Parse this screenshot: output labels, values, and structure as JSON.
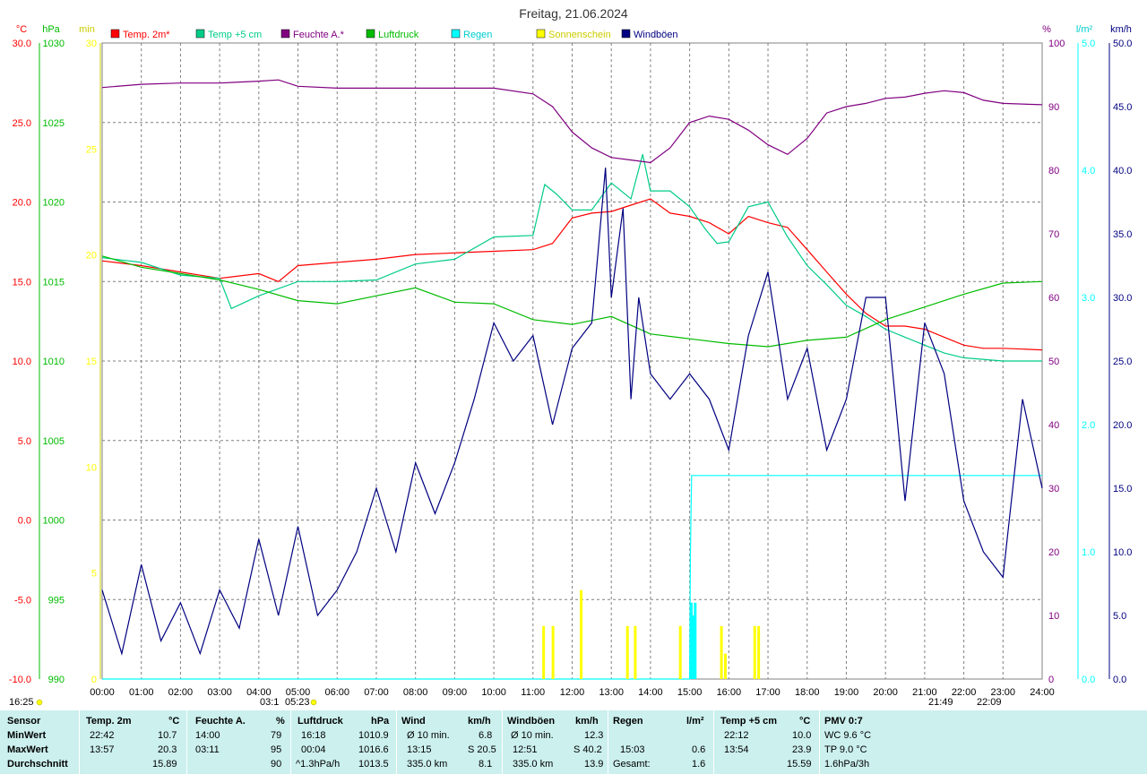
{
  "chart_data": {
    "type": "line",
    "title": "Freitag, 21.06.2024",
    "x_ticks": [
      "00:00",
      "01:00",
      "02:00",
      "03:00",
      "04:00",
      "05:00",
      "06:00",
      "07:00",
      "08:00",
      "09:00",
      "10:00",
      "11:00",
      "12:00",
      "13:00",
      "14:00",
      "15:00",
      "16:00",
      "17:00",
      "18:00",
      "19:00",
      "20:00",
      "21:00",
      "22:00",
      "23:00",
      "24:00"
    ],
    "grid": true,
    "axes": [
      {
        "id": "temp",
        "unit": "°C",
        "color": "#ff0000",
        "range": [
          -10,
          30
        ],
        "ticks": [
          "-10.0",
          "-5.0",
          "0.0",
          "5.0",
          "10.0",
          "15.0",
          "20.0",
          "25.0",
          "30.0"
        ],
        "side": "left"
      },
      {
        "id": "press",
        "unit": "hPa",
        "color": "#00bb00",
        "range": [
          990,
          1030
        ],
        "ticks": [
          "990",
          "995",
          "1000",
          "1005",
          "1010",
          "1015",
          "1020",
          "1025",
          "1030"
        ],
        "side": "left"
      },
      {
        "id": "sun",
        "unit": "min",
        "color": "#ffff00",
        "range": [
          0,
          30
        ],
        "ticks": [
          "0",
          "5",
          "10",
          "15",
          "20",
          "25",
          "30"
        ],
        "side": "left"
      },
      {
        "id": "hum",
        "unit": "%",
        "color": "#800080",
        "range": [
          0,
          100
        ],
        "ticks": [
          "0",
          "10",
          "20",
          "30",
          "40",
          "50",
          "60",
          "70",
          "80",
          "90",
          "100"
        ],
        "side": "right"
      },
      {
        "id": "rain",
        "unit": "l/m²",
        "color": "#00ffff",
        "range": [
          0,
          5
        ],
        "ticks": [
          "0.0",
          "1.0",
          "2.0",
          "3.0",
          "4.0",
          "5.0"
        ],
        "side": "right"
      },
      {
        "id": "wind",
        "unit": "km/h",
        "color": "#000080",
        "range": [
          0,
          50
        ],
        "ticks": [
          "0.0",
          "5.0",
          "10.0",
          "15.0",
          "20.0",
          "25.0",
          "30.0",
          "35.0",
          "40.0",
          "45.0",
          "50.0"
        ],
        "side": "right"
      }
    ],
    "legend": [
      {
        "name": "Temp. 2m*",
        "color": "#ff0000"
      },
      {
        "name": "Temp +5 cm",
        "color": "#00cc88"
      },
      {
        "name": "Feuchte A.*",
        "color": "#800080"
      },
      {
        "name": "Luftdruck",
        "color": "#00bb00"
      },
      {
        "name": "Regen",
        "color": "#00ffff"
      },
      {
        "name": "Sonnenschein",
        "color": "#ffff00"
      },
      {
        "name": "Windböen",
        "color": "#000080"
      }
    ],
    "series": [
      {
        "name": "Temp. 2m*",
        "axis": "temp",
        "color": "#ff0000",
        "x": [
          0,
          1,
          2,
          3,
          4,
          4.5,
          5,
          6,
          7,
          8,
          9,
          10,
          11,
          11.5,
          12,
          12.5,
          13,
          13.5,
          14,
          14.5,
          15,
          15.5,
          16,
          16.5,
          17,
          17.5,
          18,
          18.5,
          19,
          19.5,
          20,
          20.5,
          21,
          21.5,
          22,
          22.5,
          23,
          24
        ],
        "y": [
          16.3,
          16.0,
          15.6,
          15.2,
          15.5,
          15.0,
          16.0,
          16.2,
          16.4,
          16.7,
          16.8,
          16.9,
          17.0,
          17.4,
          19.0,
          19.3,
          19.4,
          19.8,
          20.2,
          19.3,
          19.1,
          18.7,
          18.0,
          19.1,
          18.7,
          18.4,
          17.0,
          15.6,
          14.2,
          13.0,
          12.2,
          12.2,
          12.0,
          11.5,
          11.0,
          10.8,
          10.8,
          10.7
        ]
      },
      {
        "name": "Temp +5 cm",
        "axis": "temp",
        "color": "#00cc88",
        "x": [
          0,
          1,
          2,
          3,
          3.3,
          4,
          5,
          6,
          7,
          8,
          9,
          10,
          11,
          11.3,
          11.6,
          12,
          12.5,
          13,
          13.5,
          13.8,
          14,
          14.5,
          15,
          15.4,
          15.7,
          16,
          16.5,
          17,
          17.5,
          18,
          18.5,
          19,
          19.5,
          20,
          20.5,
          21,
          21.5,
          22,
          23,
          24
        ],
        "y": [
          16.5,
          16.2,
          15.4,
          15.2,
          13.3,
          14.1,
          15.0,
          15.0,
          15.1,
          16.1,
          16.4,
          17.8,
          17.9,
          21.1,
          20.5,
          19.5,
          19.5,
          21.2,
          20.2,
          23.0,
          20.7,
          20.7,
          19.7,
          18.3,
          17.4,
          17.5,
          19.7,
          20.0,
          17.8,
          16.0,
          14.8,
          13.5,
          12.8,
          12.0,
          11.5,
          11.0,
          10.5,
          10.2,
          10.0,
          10.0
        ]
      },
      {
        "name": "Feuchte A.*",
        "axis": "hum",
        "color": "#800080",
        "x": [
          0,
          1,
          2,
          3,
          4,
          4.5,
          5,
          6,
          7,
          8,
          9,
          10,
          11,
          11.5,
          12,
          12.5,
          13,
          13.5,
          14,
          14.5,
          15,
          15.5,
          16,
          16.5,
          17,
          17.5,
          18,
          18.5,
          19,
          19.5,
          20,
          20.5,
          21,
          21.5,
          22,
          22.5,
          23,
          24
        ],
        "y": [
          93,
          93.5,
          93.7,
          93.7,
          94,
          94.2,
          93.2,
          92.9,
          92.9,
          92.9,
          92.9,
          92.9,
          92.0,
          90.0,
          86,
          83.5,
          82,
          81.6,
          81.2,
          83.5,
          87.5,
          88.5,
          88.0,
          86.3,
          84.0,
          82.5,
          85,
          89,
          90,
          90.5,
          91.3,
          91.5,
          92.1,
          92.5,
          92.2,
          91.0,
          90.5,
          90.3
        ]
      },
      {
        "name": "Luftdruck",
        "axis": "press",
        "color": "#00bb00",
        "x": [
          0,
          1,
          2,
          3,
          4,
          5,
          6,
          7,
          8,
          9,
          10,
          11,
          12,
          13,
          14,
          15,
          16,
          17,
          18,
          19,
          20,
          21,
          22,
          23,
          24
        ],
        "y": [
          1016.6,
          1015.9,
          1015.5,
          1015.1,
          1014.5,
          1013.8,
          1013.6,
          1014.1,
          1014.6,
          1013.7,
          1013.6,
          1012.6,
          1012.3,
          1012.8,
          1011.7,
          1011.4,
          1011.1,
          1010.9,
          1011.3,
          1011.5,
          1012.6,
          1013.4,
          1014.2,
          1014.9,
          1015.0
        ]
      },
      {
        "name": "Regen",
        "axis": "rain",
        "color": "#00ffff",
        "x": [
          0,
          15.0,
          15.02,
          15.05,
          15.1,
          24
        ],
        "y": [
          0,
          0,
          1.0,
          1.6,
          1.6,
          1.6
        ],
        "bars": [
          [
            15.03,
            0.6
          ],
          [
            15.08,
            0.5
          ],
          [
            15.13,
            0.6
          ]
        ]
      },
      {
        "name": "Windböen",
        "axis": "wind",
        "color": "#000080",
        "x": [
          0,
          0.5,
          1,
          1.5,
          2,
          2.5,
          3,
          3.5,
          4,
          4.5,
          5,
          5.5,
          6,
          6.5,
          7,
          7.5,
          8,
          8.5,
          9,
          9.5,
          10,
          10.5,
          11,
          11.5,
          12,
          12.5,
          12.85,
          13,
          13.3,
          13.5,
          13.7,
          14,
          14.5,
          15,
          15.5,
          16,
          16.5,
          17,
          17.5,
          18,
          18.5,
          19,
          19.5,
          20,
          20.5,
          21,
          21.5,
          22,
          22.5,
          23,
          23.5,
          24
        ],
        "y": [
          7,
          2,
          9,
          3,
          6,
          2,
          7,
          4,
          11,
          5,
          12,
          5,
          7,
          10,
          15,
          10,
          17,
          13,
          17,
          22,
          28,
          25,
          27,
          20,
          26,
          28,
          40.2,
          30,
          37,
          22,
          30,
          24,
          22,
          24,
          22,
          18,
          27,
          32,
          22,
          26,
          18,
          22,
          30,
          30,
          14,
          28,
          24,
          14,
          10,
          8,
          22,
          15
        ]
      },
      {
        "name": "Sonnenschein",
        "axis": "sun",
        "color": "#ffff00",
        "bars_x": [
          11.26,
          11.5,
          12.22,
          13.4,
          13.6,
          14.75,
          15.8,
          15.9,
          16.65,
          16.75
        ],
        "bars_y": [
          2.5,
          2.5,
          4.2,
          2.5,
          2.5,
          2.5,
          2.5,
          1.2,
          2.5,
          2.5
        ]
      }
    ],
    "annotations": {
      "left_start": "16:25",
      "sunrise_marker_1": "03:1",
      "sunrise_marker_2": "05:23",
      "sunset_marker_1": "21:49",
      "sunset_marker_2": "22:09"
    }
  },
  "stats": {
    "headers": {
      "sensor": "Sensor",
      "temp2m": "Temp. 2m",
      "temp2m_unit": "°C",
      "hum": "Feuchte A.",
      "hum_unit": "%",
      "press": "Luftdruck",
      "press_unit": "hPa",
      "wind": "Wind",
      "wind_unit": "km/h",
      "gust": "Windböen",
      "gust_unit": "km/h",
      "rain": "Regen",
      "rain_unit": "l/m²",
      "temp5": "Temp +5 cm",
      "temp5_unit": "°C",
      "pmv": "PMV 0:7"
    },
    "rows": [
      {
        "label": "MinWert",
        "temp_time": "22:42",
        "temp_val": "10.7",
        "hum_time": "14:00",
        "hum_val": "79",
        "press_time": "16:18",
        "press_val": "1010.9",
        "wind_time": "Ø 10 min.",
        "wind_val": "6.8",
        "gust_time": "Ø 10 min.",
        "gust_val": "12.3",
        "rain_time": "",
        "rain_val": "",
        "t5_time": "22:12",
        "t5_val": "10.0",
        "pmv": "WC 9.6 °C"
      },
      {
        "label": "MaxWert",
        "temp_time": "13:57",
        "temp_val": "20.3",
        "hum_time": "03:11",
        "hum_val": "95",
        "press_time": "00:04",
        "press_val": "1016.6",
        "wind_time": "13:15",
        "wind_val": "S 20.5",
        "gust_time": "12:51",
        "gust_val": "S 40.2",
        "rain_time": "15:03",
        "rain_val": "0.6",
        "t5_time": "13:54",
        "t5_val": "23.9",
        "pmv": "TP 9.0 °C"
      },
      {
        "label": "Durchschnitt",
        "temp_time": "",
        "temp_val": "15.89",
        "hum_time": "",
        "hum_val": "90",
        "press_time": "^1.3hPa/h",
        "press_val": "1013.5",
        "wind_time": "335.0 km",
        "wind_val": "8.1",
        "gust_time": "335.0 km",
        "gust_val": "13.9",
        "rain_time": "Gesamt:",
        "rain_val": "1.6",
        "t5_time": "",
        "t5_val": "15.59",
        "pmv": "1.6hPa/3h"
      }
    ]
  }
}
